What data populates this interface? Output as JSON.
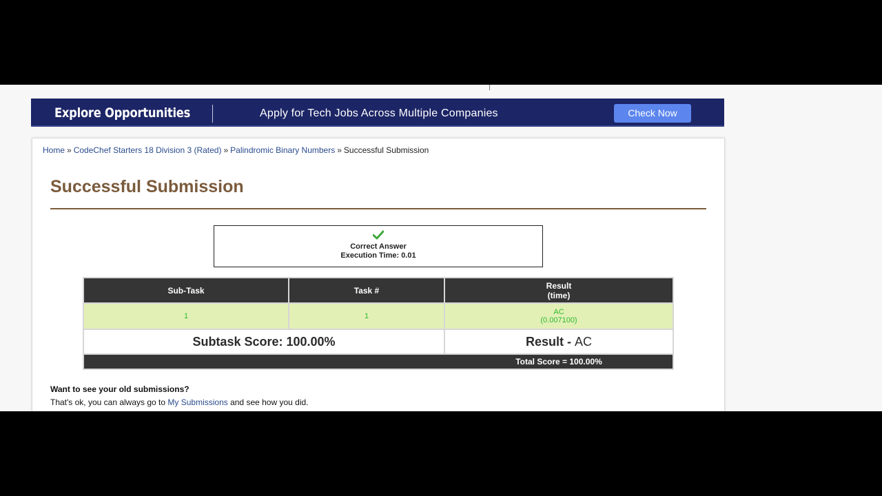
{
  "banner": {
    "left_text": "Explore Opportunities",
    "middle_text": "Apply for Tech Jobs Across Multiple Companies",
    "button_label": "Check Now"
  },
  "breadcrumb": {
    "items": [
      "Home",
      "CodeChef Starters 18 Division 3 (Rated)",
      "Palindromic Binary Numbers"
    ],
    "current": "Successful Submission",
    "separator": "»"
  },
  "page_title": "Successful Submission",
  "verdict": {
    "icon": "check-icon",
    "status": "Correct Answer",
    "execution_time": "Execution Time: 0.01"
  },
  "results_table": {
    "headers": {
      "subtask": "Sub-Task",
      "task": "Task #",
      "result_line1": "Result",
      "result_line2": "(time)"
    },
    "rows": [
      {
        "subtask": "1",
        "task": "1",
        "result": "AC",
        "time": "(0.007100)"
      }
    ],
    "subtask_score": "Subtask Score: 100.00%",
    "result_label": "Result - ",
    "result_value": "AC",
    "total_score": "Total Score = 100.00%"
  },
  "old_submissions": {
    "question": "Want to see your old submissions?",
    "text_before": "That's ok, you can always go to ",
    "link_label": "My Submissions",
    "text_after": " and see how you did."
  },
  "colors": {
    "banner_bg": "#1c2566",
    "button_bg": "#5c86ee",
    "title": "#7a5b3c",
    "header_bg": "#353535",
    "row_bg": "#e2f0b6",
    "accepted": "#2fb82f",
    "link": "#2a4b8d"
  }
}
